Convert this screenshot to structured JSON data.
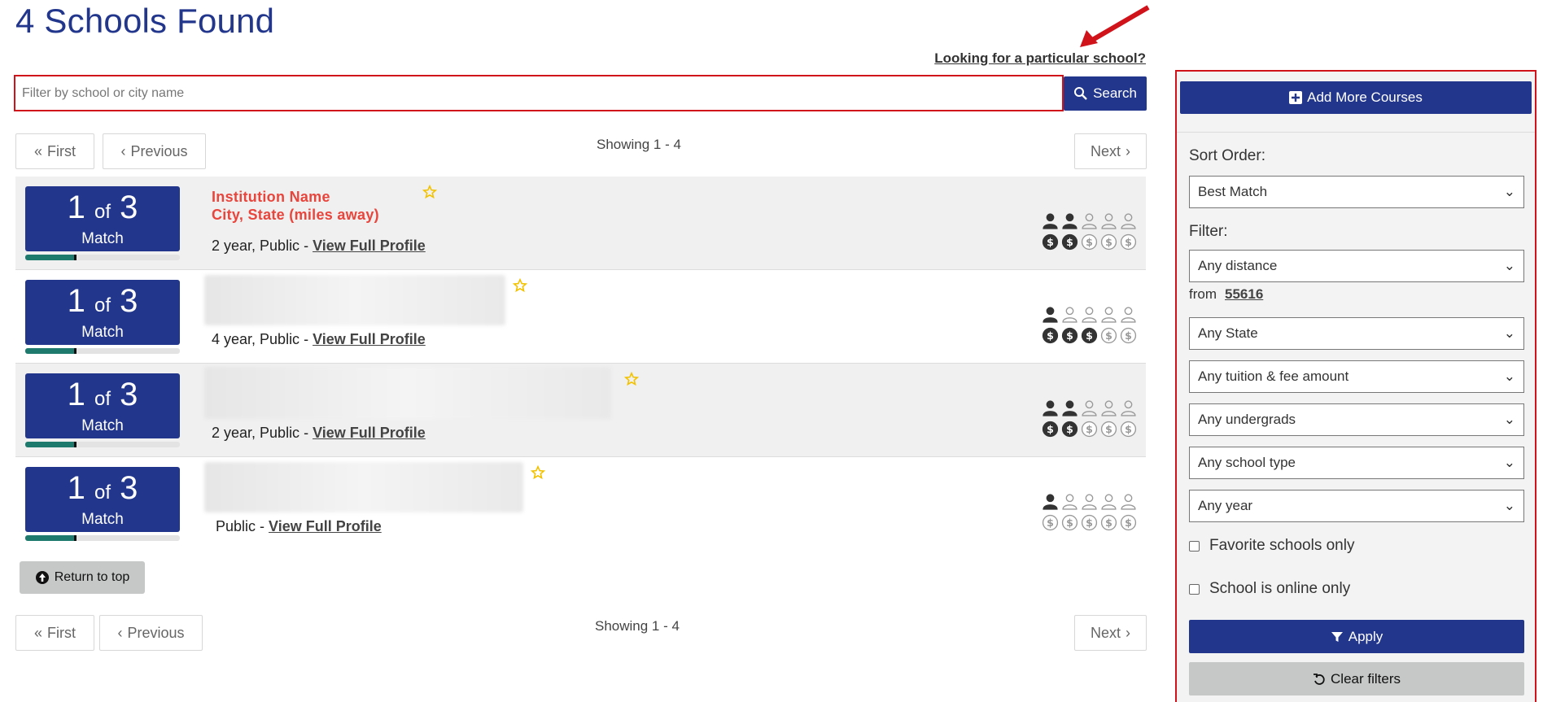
{
  "page_title": "4 Schools Found",
  "looking_link": "Looking for a particular school?",
  "search": {
    "placeholder": "Filter by school or city name",
    "button_label": "Search"
  },
  "pager_top": {
    "first": "First",
    "previous": "Previous",
    "showing": "Showing 1 - 4",
    "next": "Next"
  },
  "pager_bottom": {
    "first": "First",
    "previous": "Previous",
    "showing": "Showing 1 - 4",
    "next": "Next"
  },
  "results": [
    {
      "match_num": "1",
      "match_of": "of",
      "match_total": "3",
      "match_label": "Match",
      "name_line1": "Institution Name",
      "name_line2": "City, State (miles away)",
      "type": "2 year, Public - ",
      "profile_link": "View Full Profile",
      "size_level": 2,
      "cost_level": 2,
      "match_fraction": 0.33
    },
    {
      "match_num": "1",
      "match_of": "of",
      "match_total": "3",
      "match_label": "Match",
      "type": "4 year, Public - ",
      "profile_link": "View Full Profile",
      "size_level": 1,
      "cost_level": 3,
      "match_fraction": 0.33
    },
    {
      "match_num": "1",
      "match_of": "of",
      "match_total": "3",
      "match_label": "Match",
      "type": "2 year, Public - ",
      "profile_link": "View Full Profile",
      "size_level": 2,
      "cost_level": 2,
      "match_fraction": 0.33
    },
    {
      "match_num": "1",
      "match_of": "of",
      "match_total": "3",
      "match_label": "Match",
      "type": "Public - ",
      "profile_link": "View Full Profile",
      "size_level": 1,
      "cost_level": 0,
      "match_fraction": 0.33
    }
  ],
  "return_top": "Return to top",
  "sidebar": {
    "add_courses": "Add More Courses",
    "sort_label": "Sort Order:",
    "sort_value": "Best Match",
    "filter_label": "Filter:",
    "distance": "Any distance",
    "from_label": "from",
    "zip": "55616",
    "state": "Any State",
    "tuition": "Any tuition & fee amount",
    "undergrads": "Any undergrads",
    "school_type": "Any school type",
    "year": "Any year",
    "favorites": "Favorite schools only",
    "online": "School is online only",
    "apply": "Apply",
    "clear": "Clear filters"
  },
  "colors": {
    "brand": "#22368c",
    "highlight": "#d0121b",
    "match_bar": "#1f7a6e",
    "star": "#f2c200"
  }
}
